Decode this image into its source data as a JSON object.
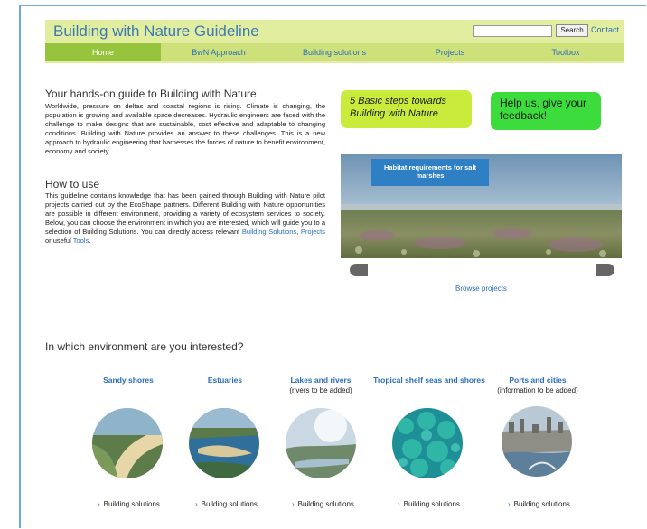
{
  "header": {
    "title": "Building with Nature Guideline",
    "search_placeholder": "",
    "search_label": "Search",
    "contact_label": "Contact"
  },
  "nav": {
    "items": [
      {
        "label": "Home",
        "active": true
      },
      {
        "label": "BwN Approach",
        "active": false
      },
      {
        "label": "Building solutions",
        "active": false
      },
      {
        "label": "Projects",
        "active": false
      },
      {
        "label": "Toolbox",
        "active": false
      }
    ]
  },
  "intro": {
    "heading": "Your hands-on guide to Building with Nature",
    "body": "Worldwide, pressure on deltas and coastal regions is rising. Climate is changing, the population is growing and available space decreases. Hydraulic engineers are faced with the challenge to make designs that are sustainable, cost effective and adaptable to changing conditions. Building with Nature provides an answer to these challenges. This is a new approach to hydraulic engineering that harnesses the forces of nature to benefit environment, economy and society."
  },
  "howto": {
    "heading": "How to use",
    "body": "This guideline contains knowledge that has been gained through Building with Nature pilot projects carried out by the EcoShape partners. Different Building with Nature opportunities are possible in different environment, providing a variety of ecosystem services to society. Below, you can choose the environment in which you are interested, which will guide you to a selection of Building Solutions. You can directly access relevant",
    "link1": "Building Solutions",
    "sep": ", ",
    "link2": "Projects",
    "mid": " or useful ",
    "link3": "Tools",
    "end": "."
  },
  "callouts": {
    "steps": "5 Basic steps towards Building with Nature",
    "feedback": "Help us, give your feedback!"
  },
  "slideshow": {
    "caption": "Habitat requirements for salt marshes",
    "browse_label": "Browse projects"
  },
  "environments": {
    "heading": "In which environment are you interested?",
    "items": [
      {
        "title": "Sandy shores",
        "sub": "",
        "bs_label": "Building solutions"
      },
      {
        "title": "Estuaries",
        "sub": "",
        "bs_label": "Building solutions"
      },
      {
        "title": "Lakes and rivers",
        "sub": "(rivers to be added)",
        "bs_label": "Building solutions"
      },
      {
        "title": "Tropical shelf seas and shores",
        "sub": "",
        "bs_label": "Building solutions"
      },
      {
        "title": "Ports and cities",
        "sub": "(information to be added)",
        "bs_label": "Building solutions"
      }
    ]
  },
  "colors": {
    "header_bg": "#e1ee9f",
    "nav_bg": "#cde07a",
    "nav_active": "#96c43c",
    "link": "#2a6ebb",
    "callout_yellow": "#c8eb3c",
    "callout_green": "#3cdc3c"
  }
}
